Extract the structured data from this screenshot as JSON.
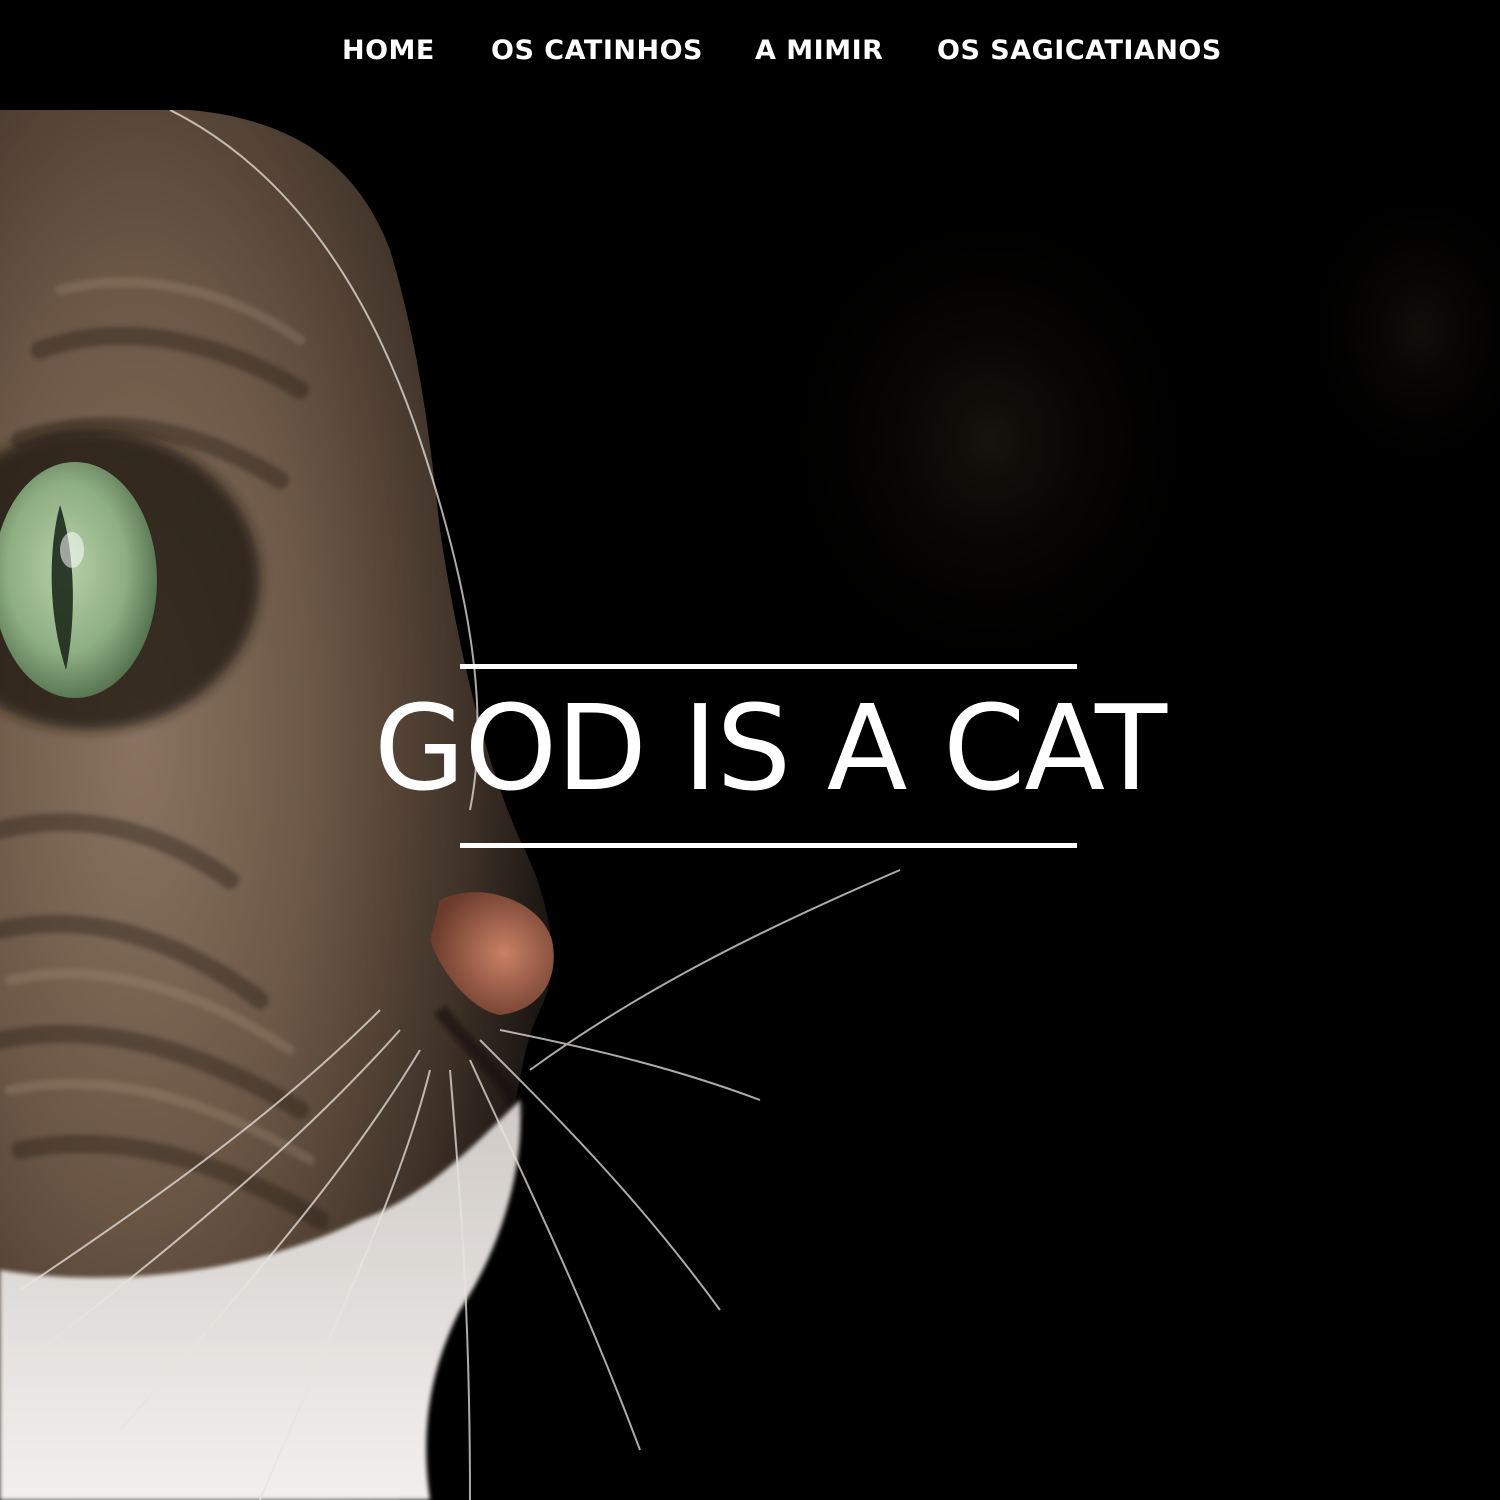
{
  "nav": {
    "items": [
      {
        "label": "HOME"
      },
      {
        "label": "OS CATINHOS"
      },
      {
        "label": "A MIMIR"
      },
      {
        "label": "OS SAGICATIANOS"
      }
    ]
  },
  "hero": {
    "title": "GOD IS A CAT",
    "background_image": "tabby-cat-closeup-photo",
    "colors": {
      "background": "#000000",
      "text": "#ffffff",
      "fur": "#6e5a48",
      "eye": "#8fb08a",
      "nose": "#b7705a",
      "chin": "#ffffff"
    }
  }
}
